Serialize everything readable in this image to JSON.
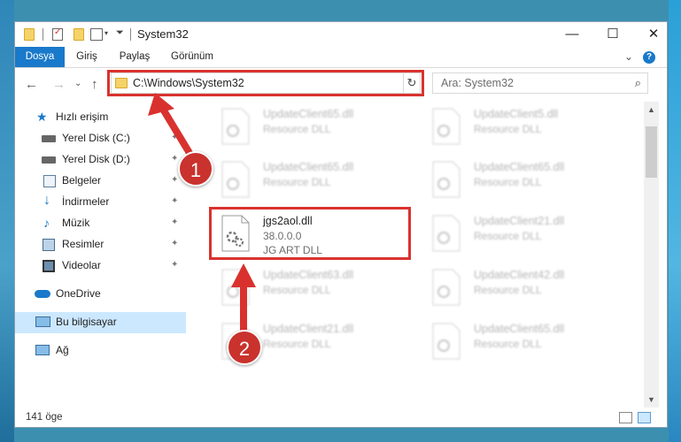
{
  "window": {
    "title": "System32",
    "controls": {
      "minimize": "—",
      "maximize": "☐",
      "close": "✕"
    }
  },
  "ribbon": {
    "tabs": [
      "Dosya",
      "Giriş",
      "Paylaş",
      "Görünüm"
    ],
    "expand_chevron": "⌄",
    "help": "?"
  },
  "nav": {
    "back": "←",
    "forward": "→",
    "recent": "⌄",
    "up": "↑",
    "address": "C:\\Windows\\System32",
    "address_chevron": "⌄",
    "refresh": "↻",
    "search_placeholder": "Ara: System32",
    "search_icon": "⌕"
  },
  "sidebar": {
    "items": [
      {
        "label": "Hızlı erişim",
        "icon": "star-icon",
        "pinned": false
      },
      {
        "label": "Yerel Disk (C:)",
        "icon": "drive-icon",
        "pinned": true
      },
      {
        "label": "Yerel Disk (D:)",
        "icon": "drive-icon",
        "pinned": true
      },
      {
        "label": "Belgeler",
        "icon": "documents-icon",
        "pinned": true
      },
      {
        "label": "İndirmeler",
        "icon": "download-icon",
        "pinned": true
      },
      {
        "label": "Müzik",
        "icon": "music-icon",
        "pinned": true
      },
      {
        "label": "Resimler",
        "icon": "pictures-icon",
        "pinned": true
      },
      {
        "label": "Videolar",
        "icon": "video-icon",
        "pinned": true
      },
      {
        "label": "OneDrive",
        "icon": "cloud-icon",
        "pinned": false
      },
      {
        "label": "Bu bilgisayar",
        "icon": "computer-icon",
        "pinned": false,
        "selected": true
      },
      {
        "label": "Ağ",
        "icon": "network-icon",
        "pinned": false
      }
    ],
    "pin_glyph": "📌"
  },
  "files": {
    "left_column": [
      {
        "name": "UpdateClient65.dll",
        "desc": "Resource DLL"
      },
      {
        "name": "UpdateClient65.dll",
        "desc": "Resource DLL"
      },
      {
        "name": "jgs2aol.dll",
        "desc": "38.0.0.0",
        "desc2": "JG ART DLL",
        "highlighted": true
      },
      {
        "name": "UpdateClient63.dll",
        "desc": "Resource DLL"
      },
      {
        "name": "UpdateClient21.dll",
        "desc": "Resource DLL"
      }
    ],
    "right_column": [
      {
        "name": "UpdateClient5.dll",
        "desc": "Resource DLL"
      },
      {
        "name": "UpdateClient65.dll",
        "desc": "Resource DLL"
      },
      {
        "name": "UpdateClient21.dll",
        "desc": "Resource DLL"
      },
      {
        "name": "UpdateClient42.dll",
        "desc": "Resource DLL"
      },
      {
        "name": "UpdateClient65.dll",
        "desc": "Resource DLL"
      }
    ]
  },
  "status": {
    "item_count": "141 öge"
  },
  "markers": {
    "step1": "1",
    "step2": "2"
  },
  "colors": {
    "accent": "#1979ca",
    "highlight_red": "#d9322e",
    "selection": "#cce8ff"
  }
}
